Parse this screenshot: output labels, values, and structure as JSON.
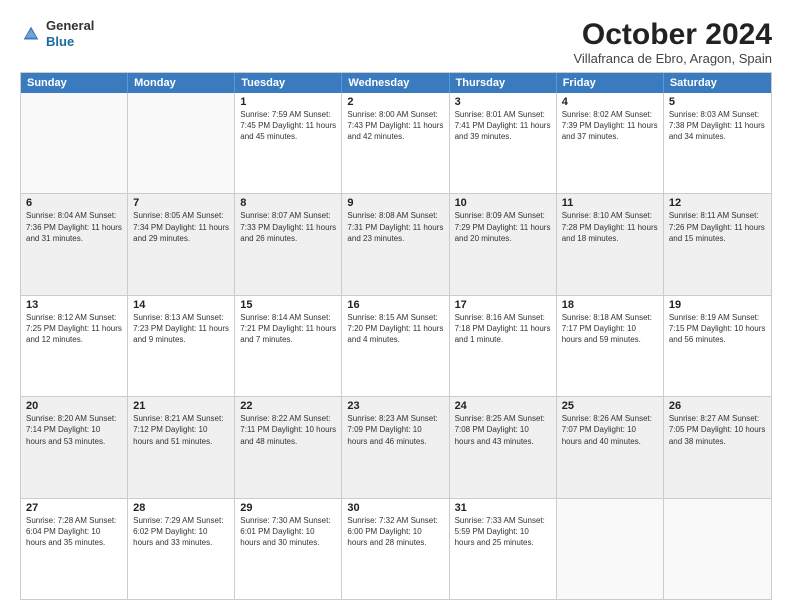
{
  "logo": {
    "general": "General",
    "blue": "Blue"
  },
  "header": {
    "title": "October 2024",
    "subtitle": "Villafranca de Ebro, Aragon, Spain"
  },
  "days": [
    "Sunday",
    "Monday",
    "Tuesday",
    "Wednesday",
    "Thursday",
    "Friday",
    "Saturday"
  ],
  "rows": [
    [
      {
        "day": "",
        "info": "",
        "empty": true
      },
      {
        "day": "",
        "info": "",
        "empty": true
      },
      {
        "day": "1",
        "info": "Sunrise: 7:59 AM\nSunset: 7:45 PM\nDaylight: 11 hours\nand 45 minutes."
      },
      {
        "day": "2",
        "info": "Sunrise: 8:00 AM\nSunset: 7:43 PM\nDaylight: 11 hours\nand 42 minutes."
      },
      {
        "day": "3",
        "info": "Sunrise: 8:01 AM\nSunset: 7:41 PM\nDaylight: 11 hours\nand 39 minutes."
      },
      {
        "day": "4",
        "info": "Sunrise: 8:02 AM\nSunset: 7:39 PM\nDaylight: 11 hours\nand 37 minutes."
      },
      {
        "day": "5",
        "info": "Sunrise: 8:03 AM\nSunset: 7:38 PM\nDaylight: 11 hours\nand 34 minutes."
      }
    ],
    [
      {
        "day": "6",
        "info": "Sunrise: 8:04 AM\nSunset: 7:36 PM\nDaylight: 11 hours\nand 31 minutes."
      },
      {
        "day": "7",
        "info": "Sunrise: 8:05 AM\nSunset: 7:34 PM\nDaylight: 11 hours\nand 29 minutes."
      },
      {
        "day": "8",
        "info": "Sunrise: 8:07 AM\nSunset: 7:33 PM\nDaylight: 11 hours\nand 26 minutes."
      },
      {
        "day": "9",
        "info": "Sunrise: 8:08 AM\nSunset: 7:31 PM\nDaylight: 11 hours\nand 23 minutes."
      },
      {
        "day": "10",
        "info": "Sunrise: 8:09 AM\nSunset: 7:29 PM\nDaylight: 11 hours\nand 20 minutes."
      },
      {
        "day": "11",
        "info": "Sunrise: 8:10 AM\nSunset: 7:28 PM\nDaylight: 11 hours\nand 18 minutes."
      },
      {
        "day": "12",
        "info": "Sunrise: 8:11 AM\nSunset: 7:26 PM\nDaylight: 11 hours\nand 15 minutes."
      }
    ],
    [
      {
        "day": "13",
        "info": "Sunrise: 8:12 AM\nSunset: 7:25 PM\nDaylight: 11 hours\nand 12 minutes."
      },
      {
        "day": "14",
        "info": "Sunrise: 8:13 AM\nSunset: 7:23 PM\nDaylight: 11 hours\nand 9 minutes."
      },
      {
        "day": "15",
        "info": "Sunrise: 8:14 AM\nSunset: 7:21 PM\nDaylight: 11 hours\nand 7 minutes."
      },
      {
        "day": "16",
        "info": "Sunrise: 8:15 AM\nSunset: 7:20 PM\nDaylight: 11 hours\nand 4 minutes."
      },
      {
        "day": "17",
        "info": "Sunrise: 8:16 AM\nSunset: 7:18 PM\nDaylight: 11 hours\nand 1 minute."
      },
      {
        "day": "18",
        "info": "Sunrise: 8:18 AM\nSunset: 7:17 PM\nDaylight: 10 hours\nand 59 minutes."
      },
      {
        "day": "19",
        "info": "Sunrise: 8:19 AM\nSunset: 7:15 PM\nDaylight: 10 hours\nand 56 minutes."
      }
    ],
    [
      {
        "day": "20",
        "info": "Sunrise: 8:20 AM\nSunset: 7:14 PM\nDaylight: 10 hours\nand 53 minutes."
      },
      {
        "day": "21",
        "info": "Sunrise: 8:21 AM\nSunset: 7:12 PM\nDaylight: 10 hours\nand 51 minutes."
      },
      {
        "day": "22",
        "info": "Sunrise: 8:22 AM\nSunset: 7:11 PM\nDaylight: 10 hours\nand 48 minutes."
      },
      {
        "day": "23",
        "info": "Sunrise: 8:23 AM\nSunset: 7:09 PM\nDaylight: 10 hours\nand 46 minutes."
      },
      {
        "day": "24",
        "info": "Sunrise: 8:25 AM\nSunset: 7:08 PM\nDaylight: 10 hours\nand 43 minutes."
      },
      {
        "day": "25",
        "info": "Sunrise: 8:26 AM\nSunset: 7:07 PM\nDaylight: 10 hours\nand 40 minutes."
      },
      {
        "day": "26",
        "info": "Sunrise: 8:27 AM\nSunset: 7:05 PM\nDaylight: 10 hours\nand 38 minutes."
      }
    ],
    [
      {
        "day": "27",
        "info": "Sunrise: 7:28 AM\nSunset: 6:04 PM\nDaylight: 10 hours\nand 35 minutes."
      },
      {
        "day": "28",
        "info": "Sunrise: 7:29 AM\nSunset: 6:02 PM\nDaylight: 10 hours\nand 33 minutes."
      },
      {
        "day": "29",
        "info": "Sunrise: 7:30 AM\nSunset: 6:01 PM\nDaylight: 10 hours\nand 30 minutes."
      },
      {
        "day": "30",
        "info": "Sunrise: 7:32 AM\nSunset: 6:00 PM\nDaylight: 10 hours\nand 28 minutes."
      },
      {
        "day": "31",
        "info": "Sunrise: 7:33 AM\nSunset: 5:59 PM\nDaylight: 10 hours\nand 25 minutes."
      },
      {
        "day": "",
        "info": "",
        "empty": true
      },
      {
        "day": "",
        "info": "",
        "empty": true
      }
    ]
  ]
}
